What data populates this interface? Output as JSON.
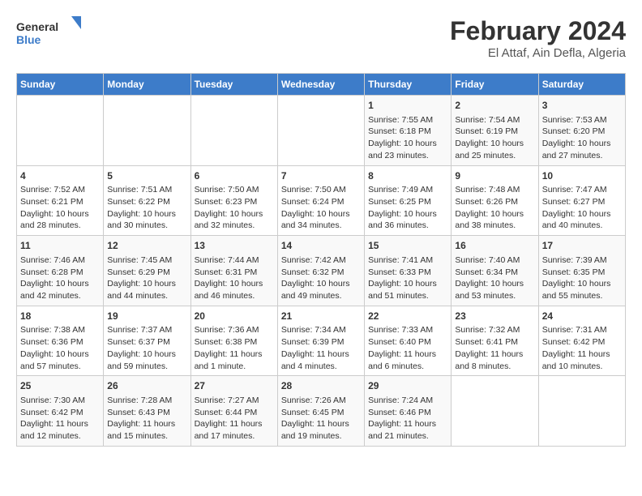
{
  "logo": {
    "line1": "General",
    "line2": "Blue"
  },
  "title": "February 2024",
  "subtitle": "El Attaf, Ain Defla, Algeria",
  "days_header": [
    "Sunday",
    "Monday",
    "Tuesday",
    "Wednesday",
    "Thursday",
    "Friday",
    "Saturday"
  ],
  "weeks": [
    [
      {
        "day": "",
        "content": ""
      },
      {
        "day": "",
        "content": ""
      },
      {
        "day": "",
        "content": ""
      },
      {
        "day": "",
        "content": ""
      },
      {
        "day": "1",
        "content": "Sunrise: 7:55 AM\nSunset: 6:18 PM\nDaylight: 10 hours\nand 23 minutes."
      },
      {
        "day": "2",
        "content": "Sunrise: 7:54 AM\nSunset: 6:19 PM\nDaylight: 10 hours\nand 25 minutes."
      },
      {
        "day": "3",
        "content": "Sunrise: 7:53 AM\nSunset: 6:20 PM\nDaylight: 10 hours\nand 27 minutes."
      }
    ],
    [
      {
        "day": "4",
        "content": "Sunrise: 7:52 AM\nSunset: 6:21 PM\nDaylight: 10 hours\nand 28 minutes."
      },
      {
        "day": "5",
        "content": "Sunrise: 7:51 AM\nSunset: 6:22 PM\nDaylight: 10 hours\nand 30 minutes."
      },
      {
        "day": "6",
        "content": "Sunrise: 7:50 AM\nSunset: 6:23 PM\nDaylight: 10 hours\nand 32 minutes."
      },
      {
        "day": "7",
        "content": "Sunrise: 7:50 AM\nSunset: 6:24 PM\nDaylight: 10 hours\nand 34 minutes."
      },
      {
        "day": "8",
        "content": "Sunrise: 7:49 AM\nSunset: 6:25 PM\nDaylight: 10 hours\nand 36 minutes."
      },
      {
        "day": "9",
        "content": "Sunrise: 7:48 AM\nSunset: 6:26 PM\nDaylight: 10 hours\nand 38 minutes."
      },
      {
        "day": "10",
        "content": "Sunrise: 7:47 AM\nSunset: 6:27 PM\nDaylight: 10 hours\nand 40 minutes."
      }
    ],
    [
      {
        "day": "11",
        "content": "Sunrise: 7:46 AM\nSunset: 6:28 PM\nDaylight: 10 hours\nand 42 minutes."
      },
      {
        "day": "12",
        "content": "Sunrise: 7:45 AM\nSunset: 6:29 PM\nDaylight: 10 hours\nand 44 minutes."
      },
      {
        "day": "13",
        "content": "Sunrise: 7:44 AM\nSunset: 6:31 PM\nDaylight: 10 hours\nand 46 minutes."
      },
      {
        "day": "14",
        "content": "Sunrise: 7:42 AM\nSunset: 6:32 PM\nDaylight: 10 hours\nand 49 minutes."
      },
      {
        "day": "15",
        "content": "Sunrise: 7:41 AM\nSunset: 6:33 PM\nDaylight: 10 hours\nand 51 minutes."
      },
      {
        "day": "16",
        "content": "Sunrise: 7:40 AM\nSunset: 6:34 PM\nDaylight: 10 hours\nand 53 minutes."
      },
      {
        "day": "17",
        "content": "Sunrise: 7:39 AM\nSunset: 6:35 PM\nDaylight: 10 hours\nand 55 minutes."
      }
    ],
    [
      {
        "day": "18",
        "content": "Sunrise: 7:38 AM\nSunset: 6:36 PM\nDaylight: 10 hours\nand 57 minutes."
      },
      {
        "day": "19",
        "content": "Sunrise: 7:37 AM\nSunset: 6:37 PM\nDaylight: 10 hours\nand 59 minutes."
      },
      {
        "day": "20",
        "content": "Sunrise: 7:36 AM\nSunset: 6:38 PM\nDaylight: 11 hours\nand 1 minute."
      },
      {
        "day": "21",
        "content": "Sunrise: 7:34 AM\nSunset: 6:39 PM\nDaylight: 11 hours\nand 4 minutes."
      },
      {
        "day": "22",
        "content": "Sunrise: 7:33 AM\nSunset: 6:40 PM\nDaylight: 11 hours\nand 6 minutes."
      },
      {
        "day": "23",
        "content": "Sunrise: 7:32 AM\nSunset: 6:41 PM\nDaylight: 11 hours\nand 8 minutes."
      },
      {
        "day": "24",
        "content": "Sunrise: 7:31 AM\nSunset: 6:42 PM\nDaylight: 11 hours\nand 10 minutes."
      }
    ],
    [
      {
        "day": "25",
        "content": "Sunrise: 7:30 AM\nSunset: 6:42 PM\nDaylight: 11 hours\nand 12 minutes."
      },
      {
        "day": "26",
        "content": "Sunrise: 7:28 AM\nSunset: 6:43 PM\nDaylight: 11 hours\nand 15 minutes."
      },
      {
        "day": "27",
        "content": "Sunrise: 7:27 AM\nSunset: 6:44 PM\nDaylight: 11 hours\nand 17 minutes."
      },
      {
        "day": "28",
        "content": "Sunrise: 7:26 AM\nSunset: 6:45 PM\nDaylight: 11 hours\nand 19 minutes."
      },
      {
        "day": "29",
        "content": "Sunrise: 7:24 AM\nSunset: 6:46 PM\nDaylight: 11 hours\nand 21 minutes."
      },
      {
        "day": "",
        "content": ""
      },
      {
        "day": "",
        "content": ""
      }
    ]
  ]
}
